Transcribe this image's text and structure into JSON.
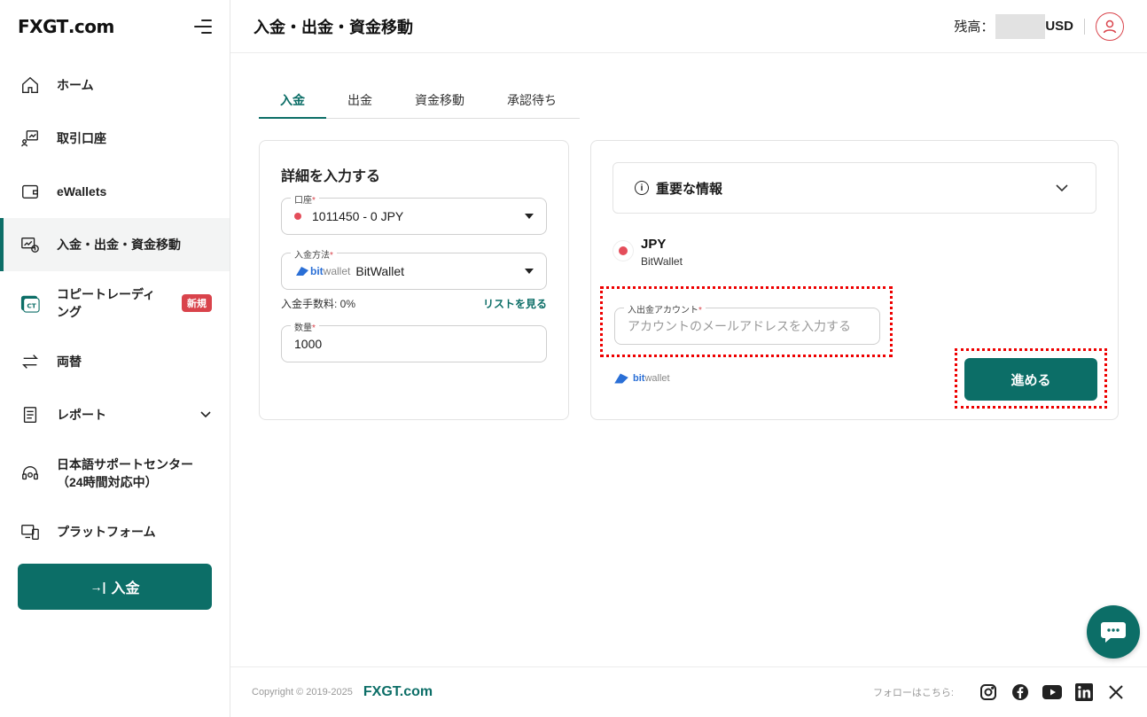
{
  "brand": {
    "logo_text_fx": "FX",
    "logo_text_gt": "GT",
    "logo_text_dom": ".com"
  },
  "sidebar": {
    "items": [
      {
        "label": "ホーム",
        "icon": "home-icon"
      },
      {
        "label": "取引口座",
        "icon": "trading-account-icon"
      },
      {
        "label": "eWallets",
        "icon": "wallet-icon"
      },
      {
        "label": "入金・出金・資金移動",
        "icon": "funds-icon",
        "active": true
      },
      {
        "label": "コピートレーディング",
        "icon": "copy-trading-icon",
        "badge": "新規"
      },
      {
        "label": "両替",
        "icon": "exchange-icon"
      },
      {
        "label": "レポート",
        "icon": "report-icon"
      },
      {
        "label": "日本語サポートセンター（24時間対応中）",
        "icon": "headset-icon"
      },
      {
        "label": "プラットフォーム",
        "icon": "platform-icon"
      }
    ],
    "deposit_button": "入金",
    "copy_trading_line1": "コピートレーディ",
    "copy_trading_line2": "ング",
    "support_line1": "日本語サポートセンター",
    "support_line2": "（24時間対応中）"
  },
  "header": {
    "title": "入金・出金・資金移動",
    "balance_label": "残高：",
    "currency": "USD"
  },
  "tabs": [
    "入金",
    "出金",
    "資金移動",
    "承認待ち"
  ],
  "form": {
    "title": "詳細を入力する",
    "account_label": "口座",
    "account_value": "1011450 - 0 JPY",
    "method_label": "入金方法",
    "method_value": "BitWallet",
    "fee_text": "入金手数料: 0%",
    "list_link": "リストを見る",
    "amount_label": "数量",
    "amount_value": "1000",
    "required_mark": "*"
  },
  "details": {
    "info_title": "重要な情報",
    "currency_code": "JPY",
    "currency_method": "BitWallet",
    "account_field_label": "入出金アカウント",
    "account_field_placeholder": "アカウントのメールアドレスを入力する",
    "proceed_button": "進める",
    "bw_bit": "bit",
    "bw_wallet": "wallet"
  },
  "footer": {
    "copyright": "Copyright © 2019-2025",
    "brand": "FXGT.com",
    "follow": "フォローはこちら:",
    "social": [
      "instagram-icon",
      "facebook-icon",
      "youtube-icon",
      "linkedin-icon",
      "x-icon"
    ]
  },
  "colors": {
    "accent": "#0c6e67",
    "danger": "#d9434b"
  }
}
